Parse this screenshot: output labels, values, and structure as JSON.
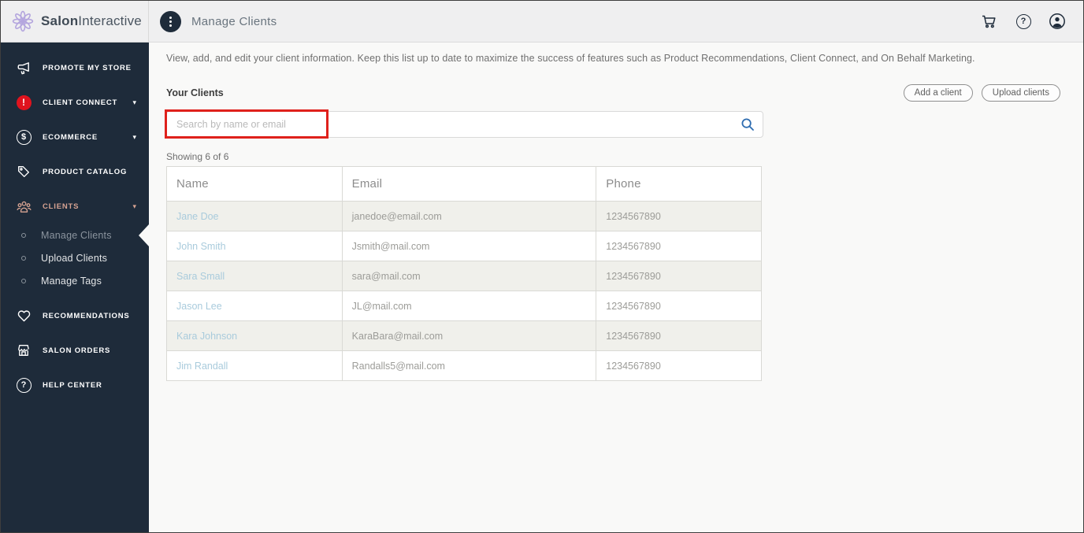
{
  "brand": {
    "name_bold": "Salon",
    "name_light": "Interactive"
  },
  "topbar": {
    "title": "Manage Clients",
    "icons": [
      "cart-icon",
      "help-icon",
      "account-icon"
    ],
    "help_glyph": "?"
  },
  "sidebar": {
    "items": [
      {
        "label": "PROMOTE MY STORE",
        "icon": "megaphone-icon"
      },
      {
        "label": "CLIENT CONNECT",
        "icon": "alert-icon",
        "chevron": "▾",
        "badge_glyph": "!"
      },
      {
        "label": "ECOMMERCE",
        "icon": "dollar-icon",
        "chevron": "▾",
        "dollar_glyph": "$"
      },
      {
        "label": "PRODUCT CATALOG",
        "icon": "tag-icon"
      },
      {
        "label": "CLIENTS",
        "icon": "people-icon",
        "chevron": "▾",
        "expanded": true,
        "accent": true,
        "children": [
          {
            "label": "Manage Clients",
            "active": true
          },
          {
            "label": "Upload Clients"
          },
          {
            "label": "Manage Tags"
          }
        ]
      },
      {
        "label": "RECOMMENDATIONS",
        "icon": "heart-icon"
      },
      {
        "label": "SALON ORDERS",
        "icon": "storefront-icon"
      },
      {
        "label": "HELP CENTER",
        "icon": "question-icon",
        "question_glyph": "?"
      }
    ]
  },
  "main": {
    "description": "View, add, and edit your client information. Keep this list up to date to maximize the success of features such as Product Recommendations, Client Connect, and On Behalf Marketing.",
    "section_title": "Your Clients",
    "buttons": {
      "add_client": "Add a client",
      "upload_clients": "Upload clients"
    },
    "search": {
      "placeholder": "Search by name or email",
      "value": ""
    },
    "showing": "Showing 6 of 6",
    "table": {
      "headers": [
        "Name",
        "Email",
        "Phone"
      ],
      "rows": [
        {
          "name": "Jane Doe",
          "email": "janedoe@email.com",
          "phone": "1234567890"
        },
        {
          "name": "John Smith",
          "email": "Jsmith@mail.com",
          "phone": "1234567890"
        },
        {
          "name": "Sara Small",
          "email": "sara@mail.com",
          "phone": "1234567890"
        },
        {
          "name": "Jason Lee",
          "email": "JL@mail.com",
          "phone": "1234567890"
        },
        {
          "name": "Kara Johnson",
          "email": "KaraBara@mail.com",
          "phone": "1234567890"
        },
        {
          "name": "Jim Randall",
          "email": "Randalls5@mail.com",
          "phone": "1234567890"
        }
      ]
    }
  },
  "colors": {
    "sidebar_bg": "#1e2b3a",
    "accent_salmon": "#d7a392",
    "alert_red": "#e0131e",
    "annotation_red": "#df211c",
    "link_blue": "#a9cbdc",
    "search_icon_blue": "#2e6cb0",
    "logo_purple": "#b4a6de",
    "row_alt_bg": "#f0f0eb"
  }
}
